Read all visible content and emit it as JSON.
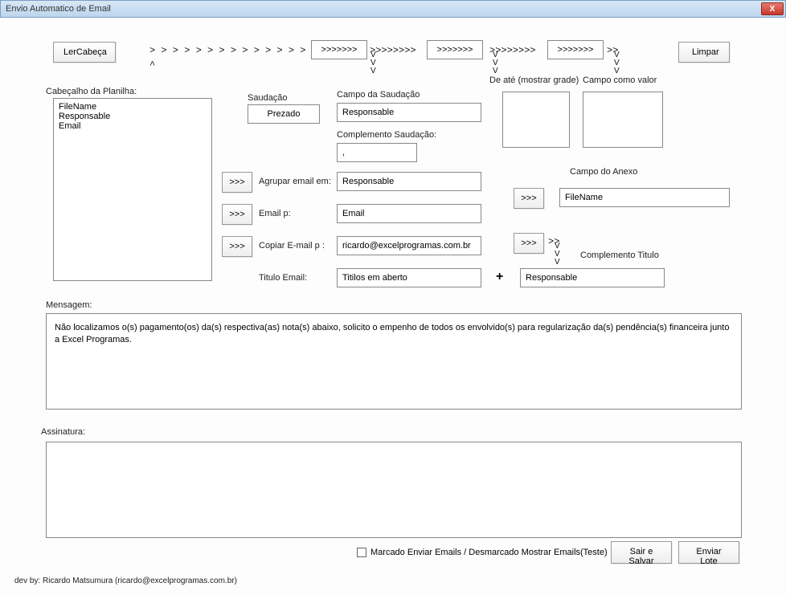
{
  "titlebar": {
    "title": "Envio Automatico de Email",
    "close": "X"
  },
  "toolbar": {
    "lerCabeca": "LerCabeça",
    "limpar": "Limpar"
  },
  "chevrons": {
    "row1_seg1": "> > > > > > > > > > > > > > > > > > >",
    "box1": ">>>>>>>",
    "mid_seg": ">>>>>>>>",
    "box2": ">>>>>>>",
    "mid_seg2": ">>>>>>>>",
    "box3": ">>>>>>>",
    "tail": ">>",
    "v3": "V\nV\nV",
    "caret_up": "^"
  },
  "labels": {
    "cabecalho": "Cabeçalho da Planilha:",
    "saudacao": "Saudação",
    "campoSaudacao": "Campo da Saudação",
    "complementoSaudacao": "Complemento Saudação:",
    "agruparEmail": "Agrupar email em:",
    "emailP": "Email p:",
    "copiarEmail": "Copiar E-mail p :",
    "tituloEmail": "Titulo Email:",
    "deAte": "De até (mostrar grade)",
    "campoValor": "Campo como valor",
    "campoAnexo": "Campo do Anexo",
    "complementoTitulo": "Complemento Titulo",
    "mensagem": "Mensagem:",
    "assinatura": "Assinatura:",
    "plus": "+",
    "btn3gt": ">>>"
  },
  "list": {
    "l1": "FileName",
    "l2": "Responsable",
    "l3": "Email"
  },
  "fields": {
    "saudacao": "Prezado",
    "campoSaudacao": "Responsable",
    "complementoSaudacao": ",",
    "agruparEmail": "Responsable",
    "emailP": "Email",
    "copiarEmail": "ricardo@excelprogramas.com.br",
    "tituloEmail": "Titilos em aberto",
    "deAte": "",
    "campoValor": "",
    "campoAnexo": "FileName",
    "complementoTitulo": "Responsable",
    "mensagem": "Não localizamos o(s) pagamento(os) da(s) respectiva(as) nota(s) abaixo, solicito o empenho de todos os envolvido(s) para regularização da(s) pendência(s) financeira junto a Excel Programas.",
    "assinatura": ""
  },
  "footer": {
    "checkbox": "Marcado Enviar Emails / Desmarcado Mostrar Emails(Teste)",
    "sairSalvar": "Sair e Salvar",
    "enviarLote": "Enviar Lote",
    "dev": "dev by: Ricardo Matsumura (ricardo@excelprogramas.com.br)"
  }
}
